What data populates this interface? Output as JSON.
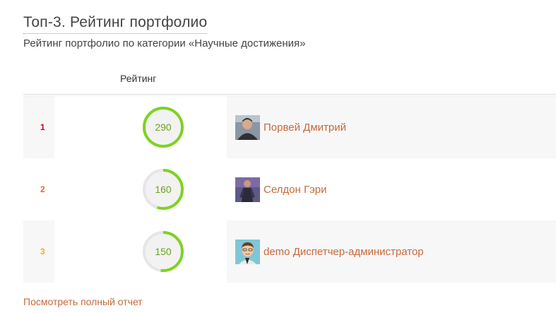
{
  "title": "Топ-3. Рейтинг портфолио",
  "subtitle": "Рейтинг портфолио по категории «Научные достижения»",
  "columns": {
    "rating": "Рейтинг"
  },
  "colors": {
    "accent_link": "#c8693a",
    "gauge_progress": "#7ed321",
    "gauge_track": "#e6e6e6",
    "gauge_fill": "#f2f2f2",
    "gauge_text": "#6aa51a",
    "rank_1": "#d0021b",
    "rank_2": "#f5641a",
    "rank_3": "#f5a623"
  },
  "rows": [
    {
      "rank": "1",
      "rating": "290",
      "progress": 1.0,
      "name": "Порвей Дмитрий",
      "avatar_icon": "user-photo-icon"
    },
    {
      "rank": "2",
      "rating": "160",
      "progress": 0.55,
      "name": "Селдон Гэри",
      "avatar_icon": "user-photo-icon"
    },
    {
      "rank": "3",
      "rating": "150",
      "progress": 0.52,
      "name": "demo Диспетчер-администратор",
      "avatar_icon": "user-avatar-cartoon-icon"
    }
  ],
  "footer": {
    "link_label": "Посмотреть полный отчет"
  }
}
